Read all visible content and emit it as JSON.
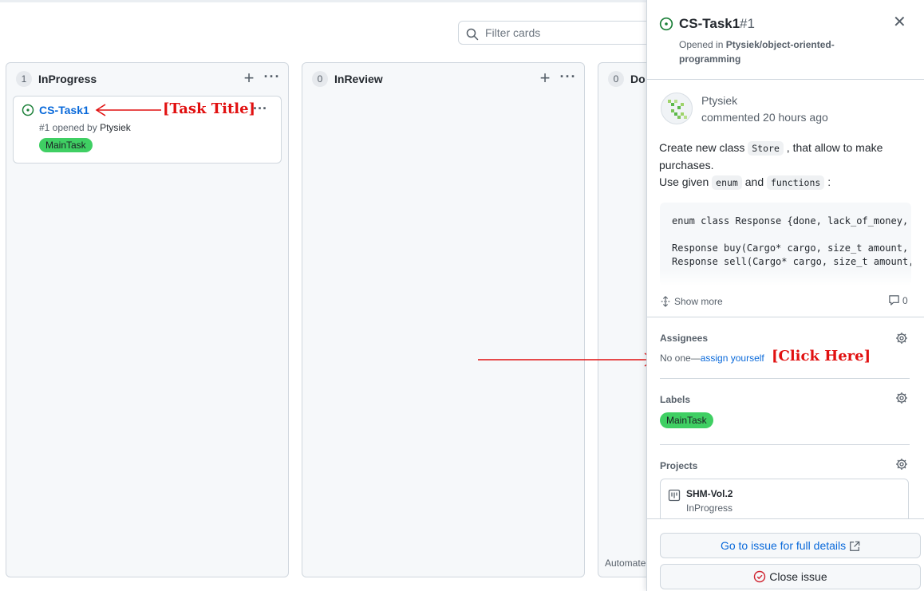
{
  "filter": {
    "placeholder": "Filter cards"
  },
  "columns": [
    {
      "count": "1",
      "name": "InProgress"
    },
    {
      "count": "0",
      "name": "InReview"
    },
    {
      "count": "0",
      "name": "Do",
      "footer": "Automate"
    }
  ],
  "card": {
    "title": "CS-Task1",
    "meta_prefix": "#1 opened by ",
    "author": "Ptysiek",
    "label": "MainTask"
  },
  "annotations": {
    "task_title": "[Task Title]",
    "click_here": "[Click Here]"
  },
  "panel": {
    "title": "CS-Task1",
    "number": "#1",
    "opened_prefix": "Opened in ",
    "repo": "Ptysiek/object-oriented-programming",
    "comment": {
      "author": "Ptysiek",
      "time": "commented 20 hours ago",
      "line1_a": "Create new class ",
      "code_store": "Store",
      "line1_b": " , that allow to make purchases.",
      "line2_a": "Use given ",
      "code_enum": "enum",
      "line2_and": " and ",
      "code_functions": "functions",
      "line2_end": " :",
      "code": "enum class Response {done, lack_of_money,\n\nResponse buy(Cargo* cargo, size_t amount,\nResponse sell(Cargo* cargo, size_t amount,",
      "show_more": "Show more",
      "comment_count": "0"
    },
    "assignees": {
      "heading": "Assignees",
      "none": "No one—",
      "link": "assign yourself"
    },
    "labels": {
      "heading": "Labels",
      "items": [
        "MainTask"
      ]
    },
    "projects": {
      "heading": "Projects",
      "name": "SHM-Vol.2",
      "column": "InProgress"
    },
    "buttons": {
      "goto": "Go to issue for full details",
      "close": "Close issue"
    }
  },
  "colors": {
    "accent": "#0969da",
    "label_green": "#3fcf63",
    "annotation_red": "#e11010",
    "open_green": "#1a7f37",
    "close_red": "#cf222e"
  }
}
